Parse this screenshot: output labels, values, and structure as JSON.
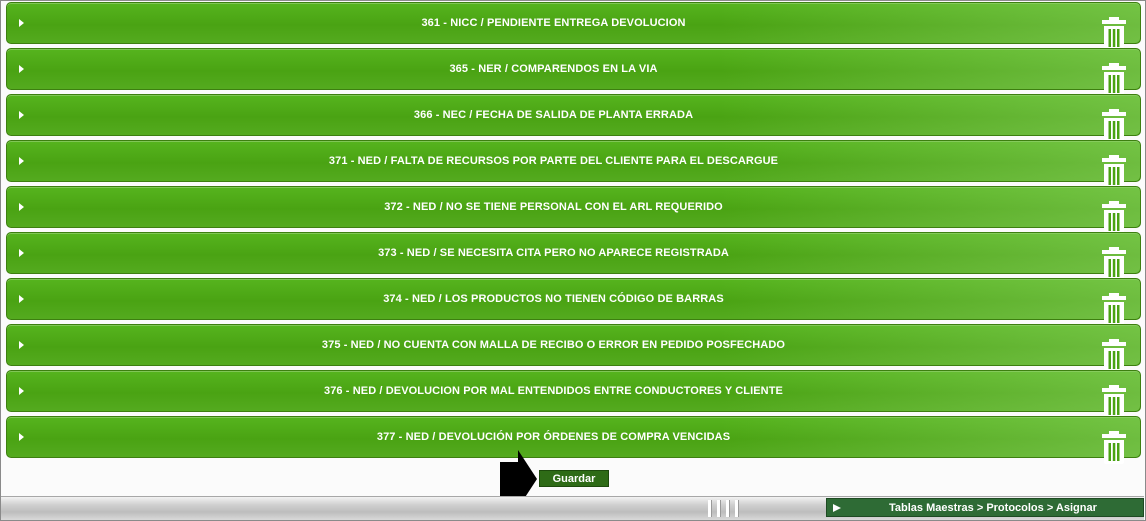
{
  "items": [
    {
      "label": "361 - NICC / PENDIENTE ENTREGA DEVOLUCION"
    },
    {
      "label": "365 - NER / COMPARENDOS EN LA VIA"
    },
    {
      "label": "366 - NEC / FECHA DE SALIDA DE PLANTA ERRADA"
    },
    {
      "label": "371 - NED / FALTA DE RECURSOS POR PARTE DEL CLIENTE PARA EL DESCARGUE"
    },
    {
      "label": "372 - NED / NO SE TIENE PERSONAL CON EL ARL REQUERIDO"
    },
    {
      "label": "373 - NED / SE NECESITA CITA PERO NO APARECE REGISTRADA"
    },
    {
      "label": "374 - NED / LOS PRODUCTOS NO TIENEN CÓDIGO DE BARRAS"
    },
    {
      "label": "375 - NED / NO CUENTA CON MALLA DE RECIBO O ERROR EN PEDIDO POSFECHADO"
    },
    {
      "label": "376 - NED / DEVOLUCION POR MAL ENTENDIDOS ENTRE CONDUCTORES Y CLIENTE"
    },
    {
      "label": "377 - NED / DEVOLUCIÓN POR ÓRDENES DE COMPRA VENCIDAS"
    }
  ],
  "actions": {
    "save_label": "Guardar"
  },
  "statusbar": {
    "breadcrumb": "Tablas Maestras > Protocolos > Asignar"
  },
  "icons": {
    "expand": "caret-right-icon",
    "delete": "trash-icon",
    "pointer": "arrow-pointer-icon"
  },
  "colors": {
    "row": "#4aa313",
    "save_button": "#2e6b16",
    "breadcrumb": "#2e6b35"
  }
}
